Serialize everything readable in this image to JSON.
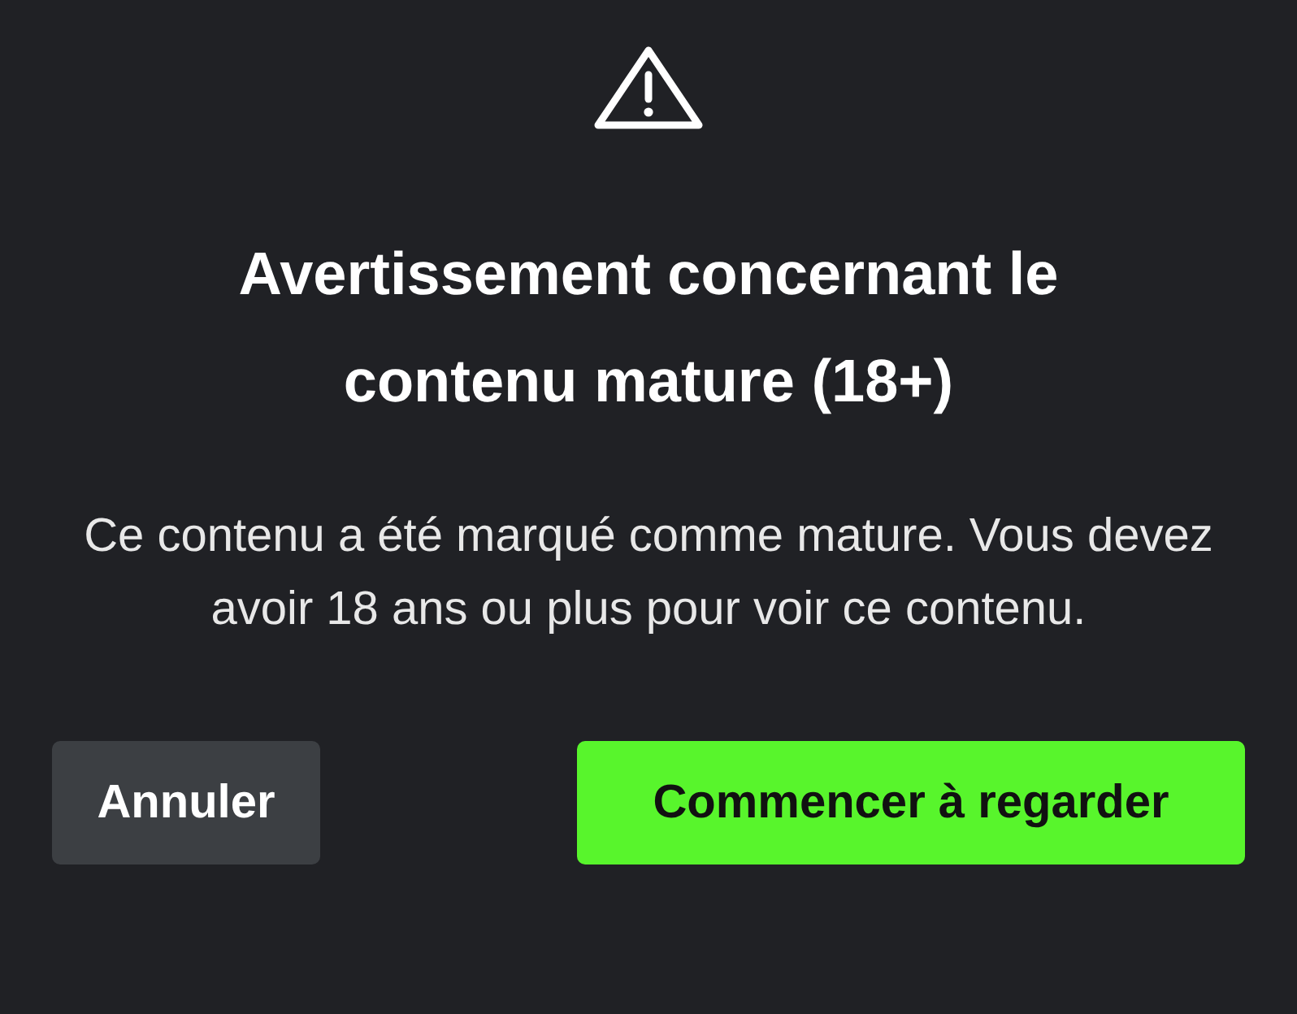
{
  "dialog": {
    "title": "Avertissement concernant le contenu mature (18+)",
    "message": "Ce contenu a été marqué comme mature. Vous devez avoir 18 ans ou plus pour voir ce contenu.",
    "buttons": [
      {
        "label": "Annuler",
        "kind": "secondary"
      },
      {
        "label": "Commencer à regarder",
        "kind": "primary"
      }
    ]
  }
}
